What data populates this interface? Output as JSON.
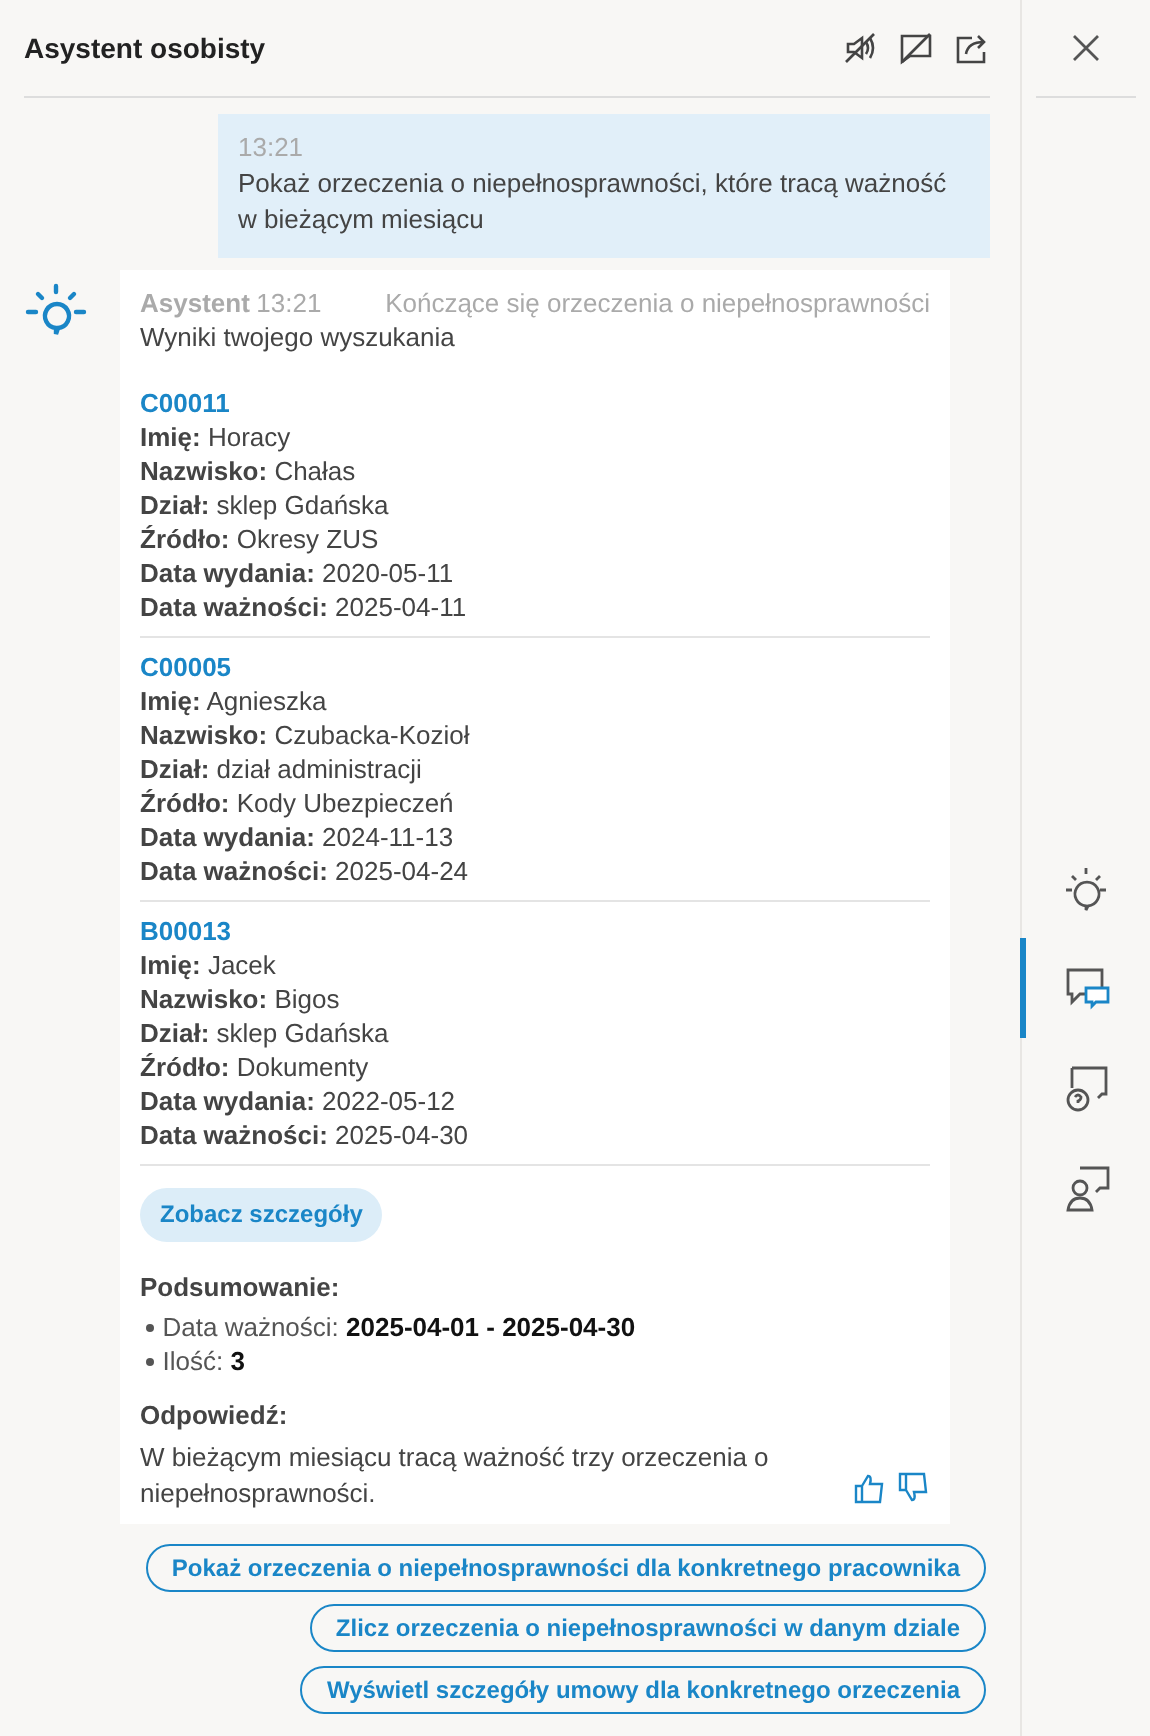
{
  "header": {
    "title": "Asystent osobisty"
  },
  "user_message": {
    "time": "13:21",
    "text": "Pokaż orzeczenia o niepełnosprawności, które tracą ważność w bieżącym miesiącu"
  },
  "assistant_message": {
    "sender": "Asystent",
    "time": "13:21",
    "topic": "Kończące się orzeczenia o niepełnosprawności",
    "intro": "Wyniki twojego wyszukania",
    "records": [
      {
        "id": "C00011",
        "fields": [
          {
            "label": "Imię:",
            "value": "Horacy"
          },
          {
            "label": "Nazwisko:",
            "value": "Chałas"
          },
          {
            "label": "Dział:",
            "value": "sklep Gdańska"
          },
          {
            "label": "Źródło:",
            "value": "Okresy ZUS"
          },
          {
            "label": "Data wydania:",
            "value": "2020-05-11"
          },
          {
            "label": "Data ważności:",
            "value": "2025-04-11"
          }
        ]
      },
      {
        "id": "C00005",
        "fields": [
          {
            "label": "Imię:",
            "value": "Agnieszka"
          },
          {
            "label": "Nazwisko:",
            "value": "Czubacka-Kozioł"
          },
          {
            "label": "Dział:",
            "value": "dział administracji"
          },
          {
            "label": "Źródło:",
            "value": "Kody Ubezpieczeń"
          },
          {
            "label": "Data wydania:",
            "value": "2024-11-13"
          },
          {
            "label": "Data ważności:",
            "value": "2025-04-24"
          }
        ]
      },
      {
        "id": "B00013",
        "fields": [
          {
            "label": "Imię:",
            "value": "Jacek"
          },
          {
            "label": "Nazwisko:",
            "value": "Bigos"
          },
          {
            "label": "Dział:",
            "value": "sklep Gdańska"
          },
          {
            "label": "Źródło:",
            "value": "Dokumenty"
          },
          {
            "label": "Data wydania:",
            "value": "2022-05-12"
          },
          {
            "label": "Data ważności:",
            "value": "2025-04-30"
          }
        ]
      }
    ],
    "details_button": "Zobacz szczegóły",
    "summary_title": "Podsumowanie:",
    "summary": [
      {
        "label": "Data ważności:",
        "value": "2025-04-01 - 2025-04-30"
      },
      {
        "label": "Ilość:",
        "value": "3"
      }
    ],
    "answer_title": "Odpowiedź:",
    "answer": "W bieżącym miesiącu tracą ważność trzy orzeczenia o niepełnosprawności."
  },
  "suggestions": [
    "Pokaż orzeczenia o niepełnosprawności dla konkretnego pracownika",
    "Zlicz orzeczenia o niepełnosprawności w danym dziale",
    "Wyświetl szczegóły umowy dla konkretnego orzeczenia"
  ],
  "side_nav": [
    {
      "kind": "bulb",
      "selected": false
    },
    {
      "kind": "chat",
      "selected": true
    },
    {
      "kind": "help",
      "selected": false
    },
    {
      "kind": "people",
      "selected": false
    }
  ]
}
